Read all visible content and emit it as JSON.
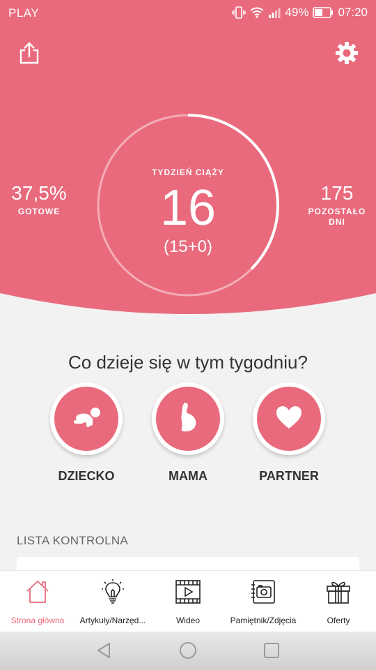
{
  "status_bar": {
    "carrier": "PLAY",
    "battery": "49%",
    "time": "07:20"
  },
  "header": {
    "share_icon": "share-icon",
    "settings_icon": "gear-icon"
  },
  "progress": {
    "left_value": "37,5%",
    "left_label": "GOTOWE",
    "week_label": "TYDZIEŃ CIĄŻY",
    "week_number": "16",
    "week_detail": "(15+0)",
    "right_value": "175",
    "right_label_line1": "POZOSTAŁO",
    "right_label_line2": "DNI",
    "progress_fraction": 0.375
  },
  "section": {
    "question": "Co dzieje się w tym tygodniu?",
    "categories": [
      {
        "label": "DZIECKO",
        "icon": "baby-crawling-icon"
      },
      {
        "label": "MAMA",
        "icon": "pregnant-belly-icon"
      },
      {
        "label": "PARTNER",
        "icon": "heart-icon"
      }
    ]
  },
  "checklist": {
    "title": "LISTA KONTROLNA"
  },
  "tabbar": {
    "tabs": [
      {
        "label": "Strona główna",
        "icon": "home-icon",
        "active": true
      },
      {
        "label": "Artykuły/Narzęd...",
        "icon": "lightbulb-icon",
        "active": false
      },
      {
        "label": "Wideo",
        "icon": "video-icon",
        "active": false
      },
      {
        "label": "Pamiętnik/Zdjęcia",
        "icon": "camera-icon",
        "active": false
      },
      {
        "label": "Oferty",
        "icon": "gift-icon",
        "active": false
      }
    ]
  },
  "colors": {
    "brand": "#e96a7c",
    "text": "#333333",
    "background": "#f2f2f2"
  }
}
